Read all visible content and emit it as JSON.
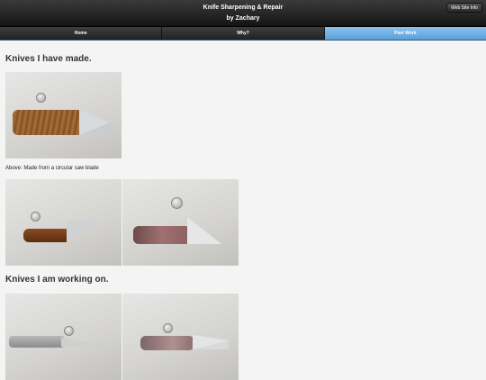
{
  "header": {
    "title_line1": "Knife Sharpening & Repair",
    "title_line2": "by Zachary",
    "info_button": "Web Site Info"
  },
  "nav": {
    "tabs": [
      {
        "label": "Home"
      },
      {
        "label": "Why?"
      },
      {
        "label": "Past Work"
      }
    ]
  },
  "sections": {
    "made_heading": "Knives I have made.",
    "made_caption": "Above: Made from a circular saw blade",
    "working_heading": "Knives I am working on."
  },
  "colors": {
    "tab_active": "#5a9fd8",
    "header_bg": "#1e1e1e"
  }
}
